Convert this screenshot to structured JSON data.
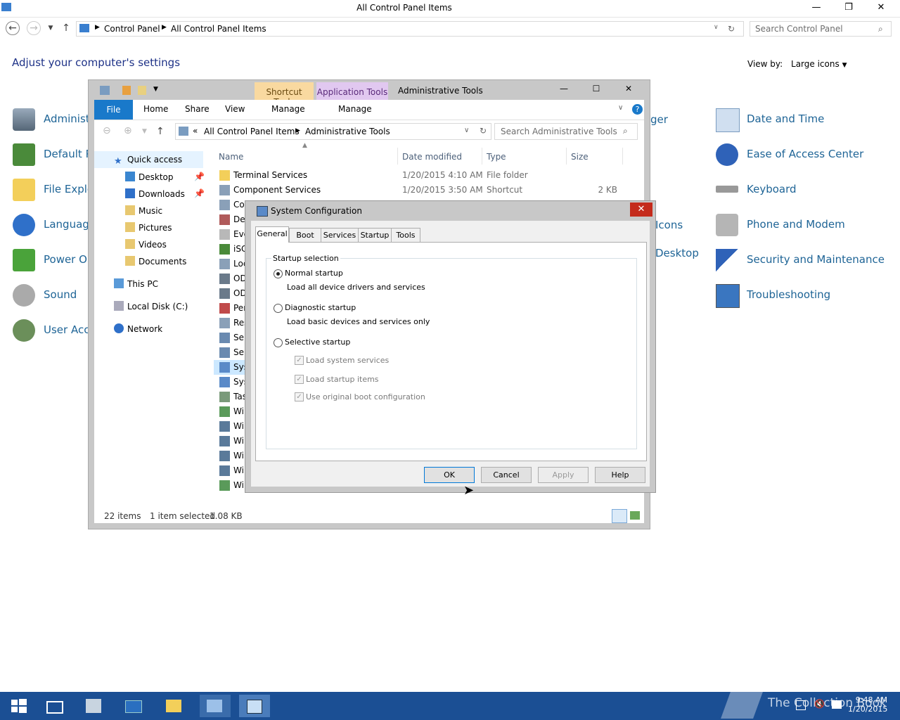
{
  "control_panel": {
    "title": "All Control Panel Items",
    "breadcrumb": [
      "Control Panel",
      "All Control Panel Items"
    ],
    "search_placeholder": "Search Control Panel",
    "heading": "Adjust your computer's settings",
    "view_by_label": "View by:",
    "view_by_value": "Large icons",
    "items_left": [
      "Administ",
      "Default P",
      "File Explo",
      "Language",
      "Power Op",
      "Sound",
      "User Acco"
    ],
    "items_mid_partial": [
      "ger",
      "Icons",
      "Desktop"
    ],
    "items_right": [
      "Date and Time",
      "Ease of Access Center",
      "Keyboard",
      "Phone and Modem",
      "Security and Maintenance",
      "Troubleshooting"
    ]
  },
  "explorer": {
    "title": "Administrative Tools",
    "context_tab_shortcut": "Shortcut Tools",
    "context_tab_app": "Application Tools",
    "ribbon_tabs": [
      "File",
      "Home",
      "Share",
      "View"
    ],
    "manage_label_1": "Manage",
    "manage_label_2": "Manage",
    "address": [
      "All Control Panel Items",
      "Administrative Tools"
    ],
    "address_prefix": "«",
    "search_placeholder": "Search Administrative Tools",
    "nav": {
      "quick_access": "Quick access",
      "items": [
        "Desktop",
        "Downloads",
        "Music",
        "Pictures",
        "Videos",
        "Documents"
      ],
      "this_pc": "This PC",
      "local_disk": "Local Disk (C:)",
      "network": "Network"
    },
    "columns": {
      "name": "Name",
      "date": "Date modified",
      "type": "Type",
      "size": "Size"
    },
    "rows": [
      {
        "name": "Terminal Services",
        "date": "1/20/2015 4:10 AM",
        "type": "File folder",
        "size": ""
      },
      {
        "name": "Component Services",
        "date": "1/20/2015 3:50 AM",
        "type": "Shortcut",
        "size": "2 KB"
      },
      {
        "name": "Co",
        "date": "",
        "type": "",
        "size": ""
      },
      {
        "name": "Def",
        "date": "",
        "type": "",
        "size": ""
      },
      {
        "name": "Eve",
        "date": "",
        "type": "",
        "size": ""
      },
      {
        "name": "iSC",
        "date": "",
        "type": "",
        "size": ""
      },
      {
        "name": "Loc",
        "date": "",
        "type": "",
        "size": ""
      },
      {
        "name": "OD",
        "date": "",
        "type": "",
        "size": ""
      },
      {
        "name": "OD",
        "date": "",
        "type": "",
        "size": ""
      },
      {
        "name": "Per",
        "date": "",
        "type": "",
        "size": ""
      },
      {
        "name": "Res",
        "date": "",
        "type": "",
        "size": ""
      },
      {
        "name": "Ser",
        "date": "",
        "type": "",
        "size": ""
      },
      {
        "name": "Ser",
        "date": "",
        "type": "",
        "size": ""
      },
      {
        "name": "Sys",
        "date": "",
        "type": "",
        "size": ""
      },
      {
        "name": "Sys",
        "date": "",
        "type": "",
        "size": ""
      },
      {
        "name": "Tas",
        "date": "",
        "type": "",
        "size": ""
      },
      {
        "name": "Wi",
        "date": "",
        "type": "",
        "size": ""
      },
      {
        "name": "Wi",
        "date": "",
        "type": "",
        "size": ""
      },
      {
        "name": "Wi",
        "date": "",
        "type": "",
        "size": ""
      },
      {
        "name": "Wi",
        "date": "",
        "type": "",
        "size": ""
      },
      {
        "name": "Wi",
        "date": "",
        "type": "",
        "size": ""
      },
      {
        "name": "Wi",
        "date": "",
        "type": "",
        "size": ""
      }
    ],
    "status_count": "22 items",
    "status_selected": "1 item selected",
    "status_size": "1.08 KB"
  },
  "sysconfig": {
    "title": "System Configuration",
    "tabs": [
      "General",
      "Boot",
      "Services",
      "Startup",
      "Tools"
    ],
    "group_label": "Startup selection",
    "normal": "Normal startup",
    "normal_desc": "Load all device drivers and services",
    "diagnostic": "Diagnostic startup",
    "diagnostic_desc": "Load basic devices and services only",
    "selective": "Selective startup",
    "chk_services": "Load system services",
    "chk_startup": "Load startup items",
    "chk_boot": "Use original boot configuration",
    "btn_ok": "OK",
    "btn_cancel": "Cancel",
    "btn_apply": "Apply",
    "btn_help": "Help"
  },
  "taskbar": {
    "watermark": "The Collection Book",
    "time": "9:48 AM",
    "date": "1/20/2015"
  },
  "colors": {
    "taskbar": "#1b4f94",
    "link": "#1e6496",
    "file_tab": "#1979ca"
  }
}
